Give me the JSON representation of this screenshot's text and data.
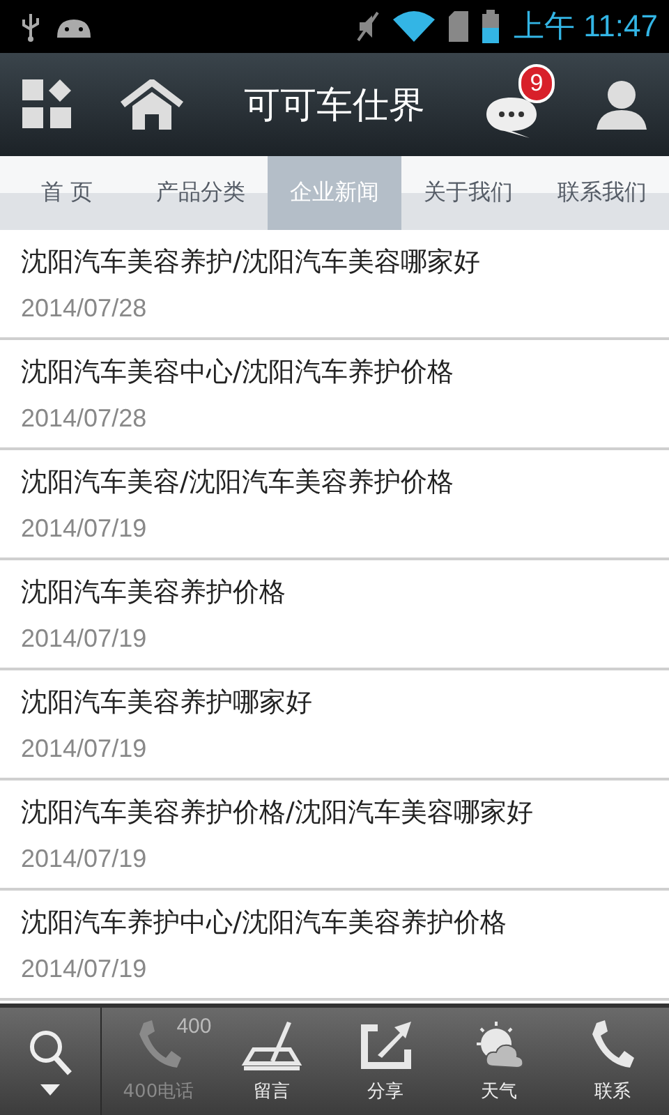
{
  "status_bar": {
    "time": "上午 11:47"
  },
  "header": {
    "title": "可可车仕界",
    "message_count": "9"
  },
  "tabs": [
    {
      "label": "首 页",
      "selected": false
    },
    {
      "label": "产品分类",
      "selected": false
    },
    {
      "label": "企业新闻",
      "selected": true
    },
    {
      "label": "关于我们",
      "selected": false
    },
    {
      "label": "联系我们",
      "selected": false
    }
  ],
  "news": [
    {
      "title": "沈阳汽车美容养护/沈阳汽车美容哪家好",
      "date": "2014/07/28"
    },
    {
      "title": "沈阳汽车美容中心/沈阳汽车养护价格",
      "date": "2014/07/28"
    },
    {
      "title": "沈阳汽车美容/沈阳汽车美容养护价格",
      "date": "2014/07/19"
    },
    {
      "title": "沈阳汽车美容养护价格",
      "date": "2014/07/19"
    },
    {
      "title": "沈阳汽车美容养护哪家好",
      "date": "2014/07/19"
    },
    {
      "title": "沈阳汽车美容养护价格/沈阳汽车美容哪家好",
      "date": "2014/07/19"
    },
    {
      "title": "沈阳汽车养护中心/沈阳汽车美容养护价格",
      "date": "2014/07/19"
    }
  ],
  "toolbar": [
    {
      "kind": "phone400",
      "label": "400电话",
      "badge": "400",
      "disabled": true
    },
    {
      "kind": "message",
      "label": "留言",
      "disabled": false
    },
    {
      "kind": "share",
      "label": "分享",
      "disabled": false
    },
    {
      "kind": "weather",
      "label": "天气",
      "disabled": false
    },
    {
      "kind": "phone",
      "label": "联系",
      "disabled": false
    }
  ]
}
